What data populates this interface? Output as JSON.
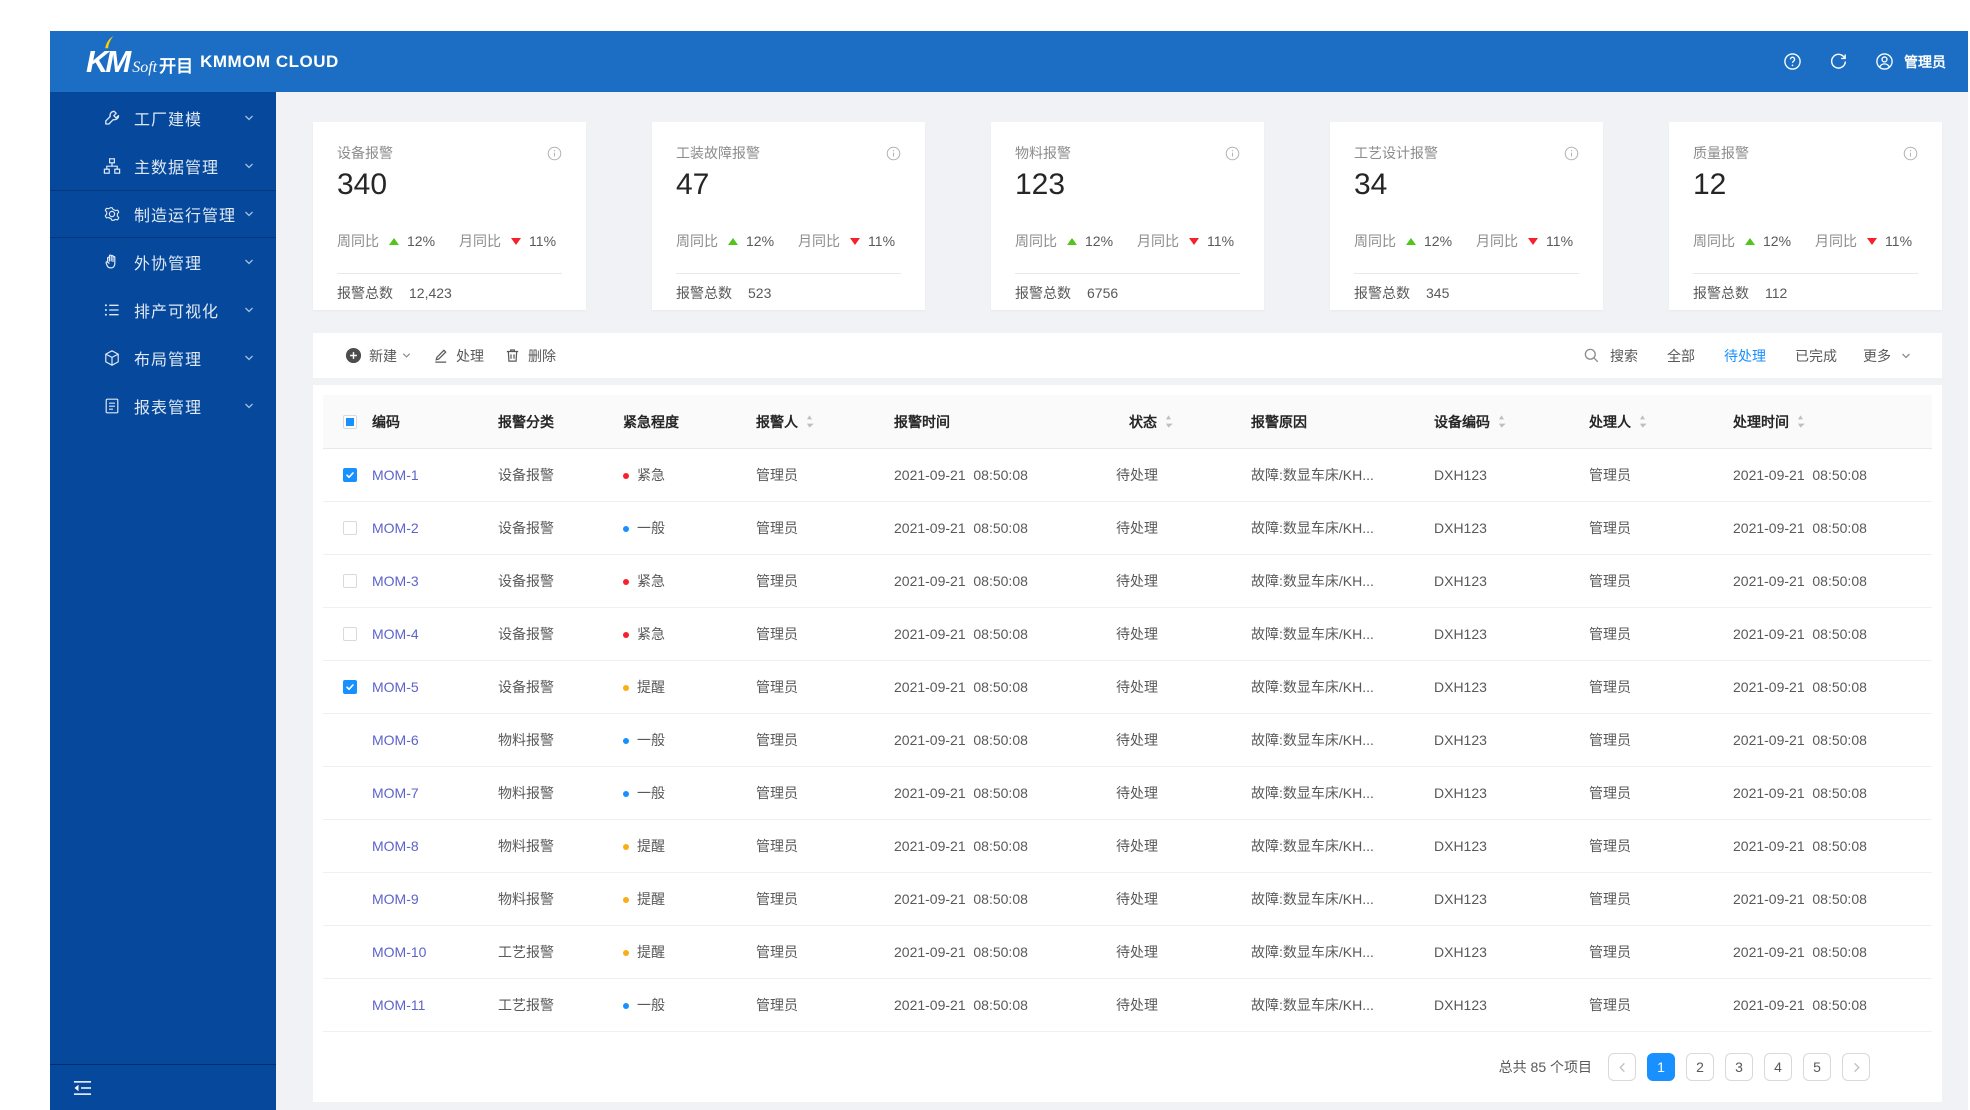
{
  "colors": {
    "accent": "#1890ff",
    "urgent": "#f5222d",
    "normal": "#1890ff",
    "remind": "#faad14",
    "up": "#52c41a",
    "down": "#f5222d"
  },
  "header": {
    "logo_km": "KM",
    "logo_soft": "Soft",
    "logo_kaimu": "开目",
    "product": "KMMOM CLOUD",
    "user": "管理员"
  },
  "sidebar": {
    "items": [
      {
        "label": "工厂建模",
        "icon": "wrench-icon",
        "grouped": false
      },
      {
        "label": "主数据管理",
        "icon": "blocks-icon",
        "grouped": false
      },
      {
        "label": "制造运行管理",
        "icon": "gear-icon",
        "grouped": true
      },
      {
        "label": "外协管理",
        "icon": "hand-icon",
        "grouped": false
      },
      {
        "label": "排产可视化",
        "icon": "list-icon",
        "grouped": false
      },
      {
        "label": "布局管理",
        "icon": "cube-icon",
        "grouped": false
      },
      {
        "label": "报表管理",
        "icon": "report-icon",
        "grouped": false
      }
    ]
  },
  "cards": [
    {
      "title": "设备报警",
      "value": "340",
      "week_label": "周同比",
      "week": "12%",
      "month_label": "月同比",
      "month": "11%",
      "total_label": "报警总数",
      "total": "12,423"
    },
    {
      "title": "工装故障报警",
      "value": "47",
      "week_label": "周同比",
      "week": "12%",
      "month_label": "月同比",
      "month": "11%",
      "total_label": "报警总数",
      "total": "523"
    },
    {
      "title": "物料报警",
      "value": "123",
      "week_label": "周同比",
      "week": "12%",
      "month_label": "月同比",
      "month": "11%",
      "total_label": "报警总数",
      "total": "6756"
    },
    {
      "title": "工艺设计报警",
      "value": "34",
      "week_label": "周同比",
      "week": "12%",
      "month_label": "月同比",
      "month": "11%",
      "total_label": "报警总数",
      "total": "345"
    },
    {
      "title": "质量报警",
      "value": "12",
      "week_label": "周同比",
      "week": "12%",
      "month_label": "月同比",
      "month": "11%",
      "total_label": "报警总数",
      "total": "112"
    }
  ],
  "toolbar": {
    "new_label": "新建",
    "edit_label": "处理",
    "delete_label": "删除",
    "search_label": "搜索",
    "filters": [
      {
        "label": "全部",
        "active": false
      },
      {
        "label": "待处理",
        "active": true
      },
      {
        "label": "已完成",
        "active": false
      }
    ],
    "more_label": "更多"
  },
  "table": {
    "columns": [
      {
        "label": "编码",
        "sort": false
      },
      {
        "label": "报警分类",
        "sort": false
      },
      {
        "label": "紧急程度",
        "sort": false
      },
      {
        "label": "报警人",
        "sort": true
      },
      {
        "label": "报警时间",
        "sort": false
      },
      {
        "label": "状态",
        "sort": true
      },
      {
        "label": "报警原因",
        "sort": false
      },
      {
        "label": "设备编码",
        "sort": true
      },
      {
        "label": "处理人",
        "sort": true
      },
      {
        "label": "处理时间",
        "sort": true
      }
    ],
    "rows": [
      {
        "check": "checked",
        "code": "MOM-1",
        "category": "设备报警",
        "urgency": "紧急",
        "level": "urgent",
        "reporter": "管理员",
        "report_time": "2021-09-21  08:50:08",
        "status": "待处理",
        "reason": "故障:数显车床/KH...",
        "device": "DXH123",
        "handler": "管理员",
        "handle_time": "2021-09-21  08:50:08"
      },
      {
        "check": "unchecked",
        "code": "MOM-2",
        "category": "设备报警",
        "urgency": "一般",
        "level": "normal",
        "reporter": "管理员",
        "report_time": "2021-09-21  08:50:08",
        "status": "待处理",
        "reason": "故障:数显车床/KH...",
        "device": "DXH123",
        "handler": "管理员",
        "handle_time": "2021-09-21  08:50:08"
      },
      {
        "check": "unchecked",
        "code": "MOM-3",
        "category": "设备报警",
        "urgency": "紧急",
        "level": "urgent",
        "reporter": "管理员",
        "report_time": "2021-09-21  08:50:08",
        "status": "待处理",
        "reason": "故障:数显车床/KH...",
        "device": "DXH123",
        "handler": "管理员",
        "handle_time": "2021-09-21  08:50:08"
      },
      {
        "check": "unchecked",
        "code": "MOM-4",
        "category": "设备报警",
        "urgency": "紧急",
        "level": "urgent",
        "reporter": "管理员",
        "report_time": "2021-09-21  08:50:08",
        "status": "待处理",
        "reason": "故障:数显车床/KH...",
        "device": "DXH123",
        "handler": "管理员",
        "handle_time": "2021-09-21  08:50:08"
      },
      {
        "check": "checked",
        "code": "MOM-5",
        "category": "设备报警",
        "urgency": "提醒",
        "level": "remind",
        "reporter": "管理员",
        "report_time": "2021-09-21  08:50:08",
        "status": "待处理",
        "reason": "故障:数显车床/KH...",
        "device": "DXH123",
        "handler": "管理员",
        "handle_time": "2021-09-21  08:50:08"
      },
      {
        "check": "none",
        "code": "MOM-6",
        "category": "物料报警",
        "urgency": "一般",
        "level": "normal",
        "reporter": "管理员",
        "report_time": "2021-09-21  08:50:08",
        "status": "待处理",
        "reason": "故障:数显车床/KH...",
        "device": "DXH123",
        "handler": "管理员",
        "handle_time": "2021-09-21  08:50:08"
      },
      {
        "check": "none",
        "code": "MOM-7",
        "category": "物料报警",
        "urgency": "一般",
        "level": "normal",
        "reporter": "管理员",
        "report_time": "2021-09-21  08:50:08",
        "status": "待处理",
        "reason": "故障:数显车床/KH...",
        "device": "DXH123",
        "handler": "管理员",
        "handle_time": "2021-09-21  08:50:08"
      },
      {
        "check": "none",
        "code": "MOM-8",
        "category": "物料报警",
        "urgency": "提醒",
        "level": "remind",
        "reporter": "管理员",
        "report_time": "2021-09-21  08:50:08",
        "status": "待处理",
        "reason": "故障:数显车床/KH...",
        "device": "DXH123",
        "handler": "管理员",
        "handle_time": "2021-09-21  08:50:08"
      },
      {
        "check": "none",
        "code": "MOM-9",
        "category": "物料报警",
        "urgency": "提醒",
        "level": "remind",
        "reporter": "管理员",
        "report_time": "2021-09-21  08:50:08",
        "status": "待处理",
        "reason": "故障:数显车床/KH...",
        "device": "DXH123",
        "handler": "管理员",
        "handle_time": "2021-09-21  08:50:08"
      },
      {
        "check": "none",
        "code": "MOM-10",
        "category": "工艺报警",
        "urgency": "提醒",
        "level": "remind",
        "reporter": "管理员",
        "report_time": "2021-09-21  08:50:08",
        "status": "待处理",
        "reason": "故障:数显车床/KH...",
        "device": "DXH123",
        "handler": "管理员",
        "handle_time": "2021-09-21  08:50:08"
      },
      {
        "check": "none",
        "code": "MOM-11",
        "category": "工艺报警",
        "urgency": "一般",
        "level": "normal",
        "reporter": "管理员",
        "report_time": "2021-09-21  08:50:08",
        "status": "待处理",
        "reason": "故障:数显车床/KH...",
        "device": "DXH123",
        "handler": "管理员",
        "handle_time": "2021-09-21  08:50:08"
      }
    ]
  },
  "pagination": {
    "total_label": "总共 85 个项目",
    "pages": [
      "1",
      "2",
      "3",
      "4",
      "5"
    ],
    "current": "1"
  }
}
